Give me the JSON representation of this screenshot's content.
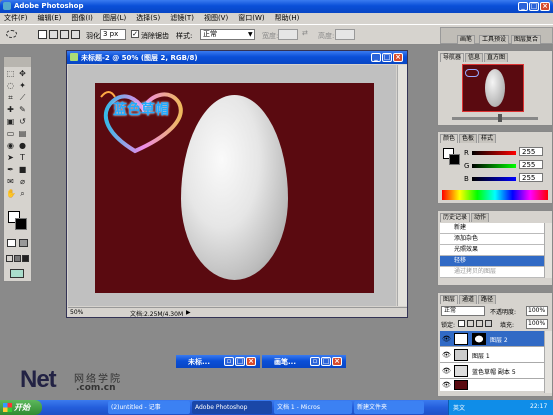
{
  "app": {
    "title": "Adobe Photoshop"
  },
  "menu": [
    "文件(F)",
    "编辑(E)",
    "图像(I)",
    "图层(L)",
    "选择(S)",
    "滤镜(T)",
    "视图(V)",
    "窗口(W)",
    "帮助(H)"
  ],
  "options": {
    "feather_label": "羽化:",
    "feather_value": "3 px",
    "antialias_label": "消除锯齿",
    "style_label": "样式:",
    "style_value": "正常",
    "width_label": "宽度:",
    "height_label": "高度:"
  },
  "palette_well": {
    "tabs": [
      "画笔",
      "工具预设",
      "图层复合"
    ]
  },
  "doc": {
    "title": "未标题-2 @ 50% (图层 2, RGB/8)",
    "zoom": "50%",
    "info": "文档:2.25M/4.30M",
    "logo_text": "蓝色草帽"
  },
  "navigator": {
    "tabs": [
      "导航器",
      "信息",
      "直方图"
    ]
  },
  "color": {
    "tabs": [
      "颜色",
      "色板",
      "样式"
    ],
    "r_label": "R",
    "g_label": "G",
    "b_label": "B",
    "r": "255",
    "g": "255",
    "b": "255"
  },
  "history": {
    "tabs": [
      "历史记录",
      "动作"
    ],
    "items": [
      "新建",
      "添加杂色",
      "光照效果",
      "轻移"
    ],
    "disabled_item": "通过拷贝的图层"
  },
  "layers": {
    "tabs": [
      "图层",
      "通道",
      "路径"
    ],
    "mode": "正常",
    "opacity_label": "不透明度:",
    "opacity": "100%",
    "lock_label": "锁定:",
    "fill_label": "填充:",
    "fill": "100%",
    "items": [
      "图层 2",
      "图层 1",
      "蓝色草帽 副本 5",
      ""
    ]
  },
  "taskbar": {
    "start": "开始",
    "items": [
      "(2)untitled - 记事",
      "Adobe Photoshop",
      "文档 1 - Micros",
      "新建文件夹"
    ],
    "clock": "22:17",
    "ime": "英文"
  },
  "minimized": [
    "未标...",
    "画笔..."
  ],
  "watermark": {
    "cn": "网络学院",
    "en": "Net",
    "url": ".com.cn"
  },
  "icons": [
    "minimize-icon",
    "maximize-icon",
    "close-icon",
    "eye-icon",
    "brush-icon",
    "lasso-icon",
    "move-icon",
    "zoom-icon"
  ]
}
